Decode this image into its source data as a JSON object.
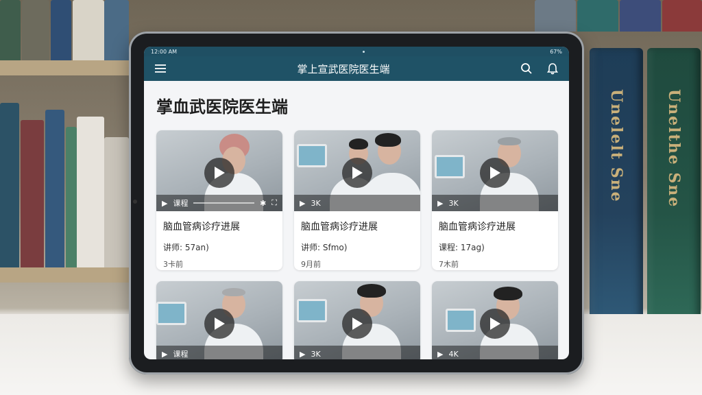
{
  "status": {
    "left": "12:00 AM",
    "right": "67%"
  },
  "app": {
    "title": "掌上宣武医院医生端"
  },
  "page": {
    "heading": "掌血武医院医生端"
  },
  "cards": [
    {
      "controls_label": "课程",
      "title": "脑血管病诊疗进展",
      "meta": "讲师: 57an)",
      "date": "3卡前"
    },
    {
      "controls_label": "3K",
      "title": "脑血管病诊疗进展",
      "meta": "讲师: Sfmo)",
      "date": "9月前"
    },
    {
      "controls_label": "3K",
      "title": "脑血管病诊疗进展",
      "meta": "课程: 17ag)",
      "date": "7木前"
    },
    {
      "controls_label": "课程",
      "title": "",
      "meta": "",
      "date": ""
    },
    {
      "controls_label": "3K",
      "title": "",
      "meta": "",
      "date": ""
    },
    {
      "controls_label": "4K",
      "title": "",
      "meta": "",
      "date": ""
    }
  ],
  "books": {
    "spine_1": "Unelelt Sne",
    "spine_2": "Unelthe Sne"
  },
  "colors": {
    "appbar": "#1f5266",
    "statusbar": "#1f4f63"
  },
  "icons": {
    "menu": "menu-icon",
    "search": "search-icon",
    "notification": "bell-icon",
    "play": "play-icon"
  }
}
